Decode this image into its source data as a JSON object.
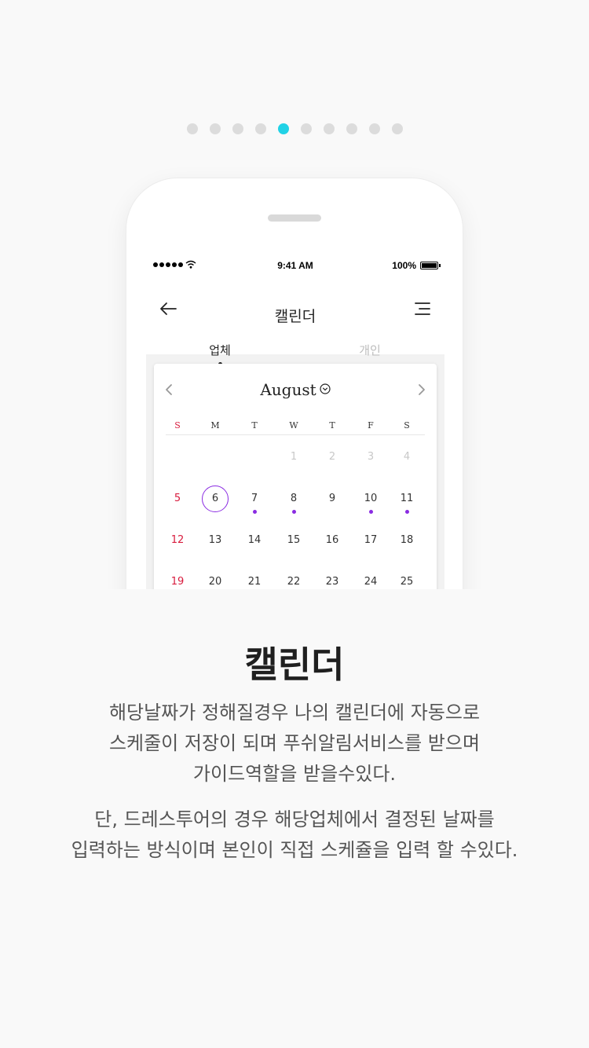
{
  "pager": {
    "count": 10,
    "active_index": 4,
    "active_color": "#21d2e6"
  },
  "status_bar": {
    "time": "9:41 AM",
    "battery": "100%"
  },
  "nav": {
    "title": "캘린더",
    "tabs": [
      {
        "label": "업체",
        "active": true
      },
      {
        "label": "개인",
        "active": false
      }
    ]
  },
  "calendar": {
    "month": "August",
    "weekdays": [
      "S",
      "M",
      "T",
      "W",
      "T",
      "F",
      "S"
    ],
    "weeks": [
      [
        "",
        "",
        "",
        "1",
        "2",
        "3",
        "4"
      ],
      [
        "5",
        "6",
        "7",
        "8",
        "9",
        "10",
        "11"
      ],
      [
        "12",
        "13",
        "14",
        "15",
        "16",
        "17",
        "18"
      ],
      [
        "19",
        "20",
        "21",
        "22",
        "23",
        "24",
        "25"
      ]
    ],
    "selected_day": "6",
    "event_days": [
      "7",
      "8",
      "10",
      "11"
    ],
    "muted_days": [
      "1",
      "2",
      "3",
      "4"
    ],
    "sunday_color": "#d81b3d",
    "accent_color": "#8a2be2"
  },
  "content": {
    "title": "캘린더",
    "description_1": [
      "해당날짜가 정해질경우 나의 캘린더에 자동으로",
      "스케줄이 저장이 되며 푸쉬알림서비스를 받으며",
      "가이드역할을 받을수있다."
    ],
    "description_2": [
      "단, 드레스투어의 경우 해당업체에서 결정된 날짜를",
      "입력하는 방식이며 본인이 직접 스케쥴을 입력 할 수있다."
    ]
  }
}
